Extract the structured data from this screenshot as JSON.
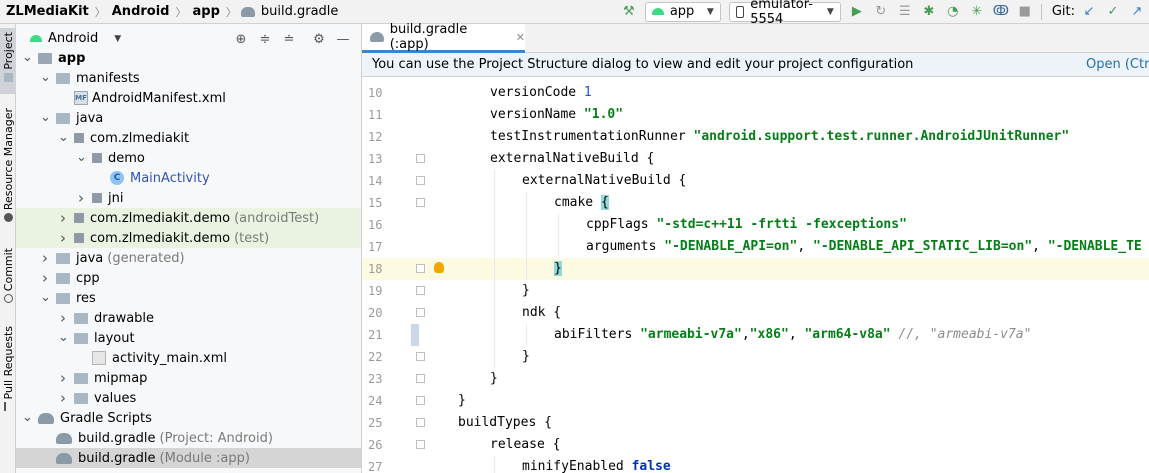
{
  "breadcrumbs": [
    "ZLMediaKit",
    "Android",
    "app",
    "build.gradle"
  ],
  "toolbar": {
    "config_value": "app",
    "device_value": "emulator-5554",
    "git_label": "Git:"
  },
  "left_tabs": [
    "Project",
    "Resource Manager",
    "Commit",
    "Pull Requests"
  ],
  "project_panel": {
    "view_mode": "Android"
  },
  "tree": [
    {
      "depth": 0,
      "chev": "v",
      "icon": "module",
      "label": "app",
      "suffix": "",
      "bold": true
    },
    {
      "depth": 1,
      "chev": "v",
      "icon": "folder",
      "label": "manifests",
      "suffix": ""
    },
    {
      "depth": 2,
      "chev": "",
      "icon": "mf",
      "label": "AndroidManifest.xml",
      "suffix": ""
    },
    {
      "depth": 1,
      "chev": "v",
      "icon": "folder",
      "label": "java",
      "suffix": ""
    },
    {
      "depth": 2,
      "chev": "v",
      "icon": "pkg",
      "label": "com.zlmediakit",
      "suffix": ""
    },
    {
      "depth": 3,
      "chev": "v",
      "icon": "pkg",
      "label": "demo",
      "suffix": ""
    },
    {
      "depth": 4,
      "chev": "",
      "icon": "class",
      "label": "MainActivity",
      "suffix": "",
      "blue": true
    },
    {
      "depth": 3,
      "chev": ">",
      "icon": "pkg",
      "label": "jni",
      "suffix": ""
    },
    {
      "depth": 2,
      "chev": ">",
      "icon": "pkg",
      "label": "com.zlmediakit.demo",
      "suffix": "(androidTest)",
      "hl": true
    },
    {
      "depth": 2,
      "chev": ">",
      "icon": "pkg",
      "label": "com.zlmediakit.demo",
      "suffix": "(test)",
      "hl": true
    },
    {
      "depth": 1,
      "chev": ">",
      "icon": "folder",
      "label": "java",
      "suffix": "(generated)"
    },
    {
      "depth": 1,
      "chev": ">",
      "icon": "folder",
      "label": "cpp",
      "suffix": ""
    },
    {
      "depth": 1,
      "chev": "v",
      "icon": "folder",
      "label": "res",
      "suffix": ""
    },
    {
      "depth": 2,
      "chev": ">",
      "icon": "folder",
      "label": "drawable",
      "suffix": ""
    },
    {
      "depth": 2,
      "chev": "v",
      "icon": "folder",
      "label": "layout",
      "suffix": ""
    },
    {
      "depth": 3,
      "chev": "",
      "icon": "xml",
      "label": "activity_main.xml",
      "suffix": ""
    },
    {
      "depth": 2,
      "chev": ">",
      "icon": "folder",
      "label": "mipmap",
      "suffix": ""
    },
    {
      "depth": 2,
      "chev": ">",
      "icon": "folder",
      "label": "values",
      "suffix": ""
    },
    {
      "depth": 0,
      "chev": "v",
      "icon": "gradle-scripts",
      "label": "Gradle Scripts",
      "suffix": ""
    },
    {
      "depth": 1,
      "chev": "",
      "icon": "gradle",
      "label": "build.gradle",
      "suffix": "(Project: Android)"
    },
    {
      "depth": 1,
      "chev": "",
      "icon": "gradle",
      "label": "build.gradle",
      "suffix": "(Module :app)",
      "sel": true
    }
  ],
  "editor": {
    "tab_label": "build.gradle (:app)",
    "banner_text": "You can use the Project Structure dialog to view and edit your project configuration",
    "banner_link": "Open (Ctrl-",
    "lines": [
      {
        "n": "10",
        "indent": 3,
        "parts": [
          [
            "",
            "versionCode "
          ],
          [
            "num",
            "1"
          ]
        ]
      },
      {
        "n": "11",
        "indent": 3,
        "parts": [
          [
            "",
            "versionName "
          ],
          [
            "str",
            "\"1.0\""
          ]
        ]
      },
      {
        "n": "12",
        "indent": 3,
        "parts": [
          [
            "",
            "testInstrumentationRunner "
          ],
          [
            "str",
            "\"android.support.test.runner.AndroidJUnitRunner\""
          ]
        ]
      },
      {
        "n": "13",
        "indent": 3,
        "fold": true,
        "parts": [
          [
            "",
            "externalNativeBuild {"
          ]
        ]
      },
      {
        "n": "14",
        "indent": 4,
        "fold": true,
        "parts": [
          [
            "",
            "externalNativeBuild {"
          ]
        ]
      },
      {
        "n": "15",
        "indent": 5,
        "fold": true,
        "parts": [
          [
            "",
            "cmake "
          ],
          [
            "brace",
            "{"
          ]
        ]
      },
      {
        "n": "16",
        "indent": 6,
        "parts": [
          [
            "",
            "cppFlags "
          ],
          [
            "str",
            "\"-std=c++11 -frtti -fexceptions\""
          ]
        ]
      },
      {
        "n": "17",
        "indent": 6,
        "parts": [
          [
            "",
            "arguments "
          ],
          [
            "str",
            "\"-DENABLE_API=on\""
          ],
          [
            "",
            ", "
          ],
          [
            "str",
            "\"-DENABLE_API_STATIC_LIB=on\""
          ],
          [
            "",
            ", "
          ],
          [
            "str",
            "\"-DENABLE_TE"
          ]
        ]
      },
      {
        "n": "18",
        "indent": 5,
        "fold": true,
        "cur": true,
        "bulb": true,
        "parts": [
          [
            "brace",
            "}"
          ]
        ]
      },
      {
        "n": "19",
        "indent": 4,
        "fold": true,
        "parts": [
          [
            "",
            "}"
          ]
        ]
      },
      {
        "n": "20",
        "indent": 4,
        "fold": true,
        "parts": [
          [
            "",
            "ndk {"
          ]
        ]
      },
      {
        "n": "21",
        "indent": 5,
        "chg": true,
        "parts": [
          [
            "",
            "abiFilters "
          ],
          [
            "str",
            "\"armeabi-v7a\""
          ],
          [
            "",
            ","
          ],
          [
            "str",
            "\"x86\""
          ],
          [
            "",
            ", "
          ],
          [
            "str",
            "\"arm64-v8a\""
          ],
          [
            "",
            " "
          ],
          [
            "cmt",
            "//, \"armeabi-v7a\""
          ]
        ]
      },
      {
        "n": "22",
        "indent": 4,
        "fold": true,
        "parts": [
          [
            "",
            "}"
          ]
        ]
      },
      {
        "n": "23",
        "indent": 3,
        "fold": true,
        "parts": [
          [
            "",
            "}"
          ]
        ]
      },
      {
        "n": "24",
        "indent": 2,
        "fold": true,
        "parts": [
          [
            "",
            "}"
          ]
        ]
      },
      {
        "n": "25",
        "indent": 2,
        "fold": true,
        "parts": [
          [
            "",
            "buildTypes {"
          ]
        ]
      },
      {
        "n": "26",
        "indent": 3,
        "fold": true,
        "parts": [
          [
            "",
            "release {"
          ]
        ]
      },
      {
        "n": "27",
        "indent": 4,
        "parts": [
          [
            "",
            "minifyEnabled "
          ],
          [
            "kw",
            "false"
          ]
        ]
      }
    ]
  }
}
